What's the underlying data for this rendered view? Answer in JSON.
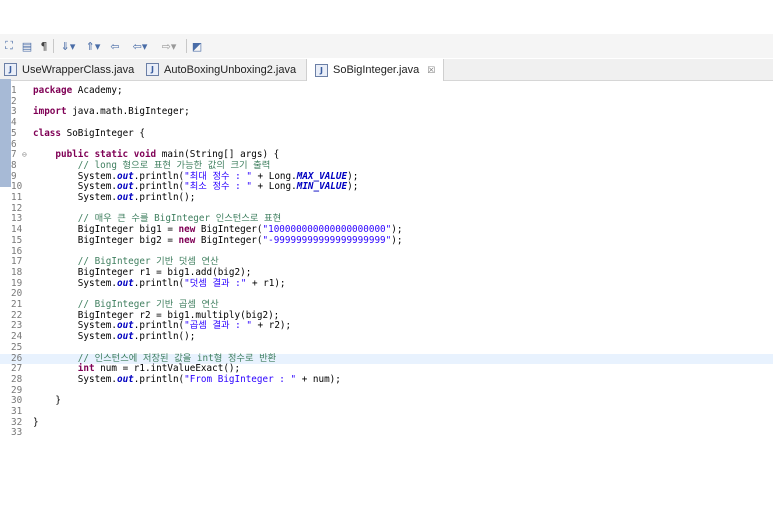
{
  "toolbar": {
    "icons": [
      "perspective-icon",
      "outline-icon",
      "pilcrow-icon",
      "next-annotation-icon",
      "prev-annotation-icon",
      "back-edit-icon",
      "back-icon",
      "forward-icon",
      "open-task-icon"
    ]
  },
  "tabs": [
    {
      "label": "UseWrapperClass.java",
      "active": false
    },
    {
      "label": "AutoBoxingUnboxing2.java",
      "active": false
    },
    {
      "label": "SoBigInteger.java",
      "active": true,
      "close": "☒"
    }
  ],
  "code_lines": [
    {
      "n": "1",
      "parts": [
        [
          "kw",
          "package"
        ],
        [
          "p",
          " Academy;"
        ]
      ]
    },
    {
      "n": "2",
      "parts": []
    },
    {
      "n": "3",
      "parts": [
        [
          "kw",
          "import"
        ],
        [
          "p",
          " java.math.BigInteger;"
        ]
      ]
    },
    {
      "n": "4",
      "parts": []
    },
    {
      "n": "5",
      "parts": [
        [
          "kw",
          "class"
        ],
        [
          "p",
          " SoBigInteger {"
        ]
      ]
    },
    {
      "n": "6",
      "parts": []
    },
    {
      "n": "7",
      "fold": "⊖",
      "parts": [
        [
          "p",
          "    "
        ],
        [
          "kw",
          "public static void"
        ],
        [
          "p",
          " main(String[] args) {"
        ]
      ]
    },
    {
      "n": "8",
      "parts": [
        [
          "p",
          "        "
        ],
        [
          "cm",
          "// long 형으로 표현 가능한 값의 크기 출력"
        ]
      ]
    },
    {
      "n": "9",
      "parts": [
        [
          "p",
          "        System."
        ],
        [
          "st",
          "out"
        ],
        [
          "p",
          ".println("
        ],
        [
          "str",
          "\"최대 정수 : \""
        ],
        [
          "p",
          " + Long."
        ],
        [
          "st",
          "MAX_VALUE"
        ],
        [
          "p",
          ");"
        ]
      ]
    },
    {
      "n": "10",
      "parts": [
        [
          "p",
          "        System."
        ],
        [
          "st",
          "out"
        ],
        [
          "p",
          ".println("
        ],
        [
          "str",
          "\"최소 정수 : \""
        ],
        [
          "p",
          " + Long."
        ],
        [
          "st",
          "MIN_VALUE"
        ],
        [
          "p",
          ");"
        ]
      ]
    },
    {
      "n": "11",
      "parts": [
        [
          "p",
          "        System."
        ],
        [
          "st",
          "out"
        ],
        [
          "p",
          ".println();"
        ]
      ]
    },
    {
      "n": "12",
      "parts": []
    },
    {
      "n": "13",
      "parts": [
        [
          "p",
          "        "
        ],
        [
          "cm",
          "// 매우 큰 수를 BigInteger 인스턴스로 표현"
        ]
      ]
    },
    {
      "n": "14",
      "parts": [
        [
          "p",
          "        BigInteger big1 = "
        ],
        [
          "kw",
          "new"
        ],
        [
          "p",
          " BigInteger("
        ],
        [
          "str",
          "\"100000000000000000000\""
        ],
        [
          "p",
          ");"
        ]
      ]
    },
    {
      "n": "15",
      "parts": [
        [
          "p",
          "        BigInteger big2 = "
        ],
        [
          "kw",
          "new"
        ],
        [
          "p",
          " BigInteger("
        ],
        [
          "str",
          "\"-99999999999999999999\""
        ],
        [
          "p",
          ");"
        ]
      ]
    },
    {
      "n": "16",
      "parts": []
    },
    {
      "n": "17",
      "parts": [
        [
          "p",
          "        "
        ],
        [
          "cm",
          "// BigInteger 기반 덧셈 연산"
        ]
      ]
    },
    {
      "n": "18",
      "parts": [
        [
          "p",
          "        BigInteger r1 = big1.add(big2);"
        ]
      ]
    },
    {
      "n": "19",
      "parts": [
        [
          "p",
          "        System."
        ],
        [
          "st",
          "out"
        ],
        [
          "p",
          ".println("
        ],
        [
          "str",
          "\"덧셈 결과 :\""
        ],
        [
          "p",
          " + r1);"
        ]
      ]
    },
    {
      "n": "20",
      "parts": []
    },
    {
      "n": "21",
      "parts": [
        [
          "p",
          "        "
        ],
        [
          "cm",
          "// BigInteger 기반 곱셈 연산"
        ]
      ]
    },
    {
      "n": "22",
      "parts": [
        [
          "p",
          "        BigInteger r2 = big1.multiply(big2);"
        ]
      ]
    },
    {
      "n": "23",
      "parts": [
        [
          "p",
          "        System."
        ],
        [
          "st",
          "out"
        ],
        [
          "p",
          ".println("
        ],
        [
          "str",
          "\"곱셈 결과 : \""
        ],
        [
          "p",
          " + r2);"
        ]
      ]
    },
    {
      "n": "24",
      "parts": [
        [
          "p",
          "        System."
        ],
        [
          "st",
          "out"
        ],
        [
          "p",
          ".println();"
        ]
      ]
    },
    {
      "n": "25",
      "parts": []
    },
    {
      "n": "26",
      "current": true,
      "parts": [
        [
          "p",
          "        "
        ],
        [
          "cm",
          "// 인스턴스에 저장된 값을 int형 정수로 반환"
        ]
      ]
    },
    {
      "n": "27",
      "parts": [
        [
          "p",
          "        "
        ],
        [
          "kw",
          "int"
        ],
        [
          "p",
          " num = r1.intValueExact();"
        ]
      ]
    },
    {
      "n": "28",
      "parts": [
        [
          "p",
          "        System."
        ],
        [
          "st",
          "out"
        ],
        [
          "p",
          ".println("
        ],
        [
          "str",
          "\"From BigInteger : \""
        ],
        [
          "p",
          " + num);"
        ]
      ]
    },
    {
      "n": "29",
      "parts": []
    },
    {
      "n": "30",
      "parts": [
        [
          "p",
          "    }"
        ]
      ]
    },
    {
      "n": "31",
      "parts": []
    },
    {
      "n": "32",
      "parts": [
        [
          "p",
          "}"
        ]
      ]
    },
    {
      "n": "33",
      "parts": []
    }
  ]
}
